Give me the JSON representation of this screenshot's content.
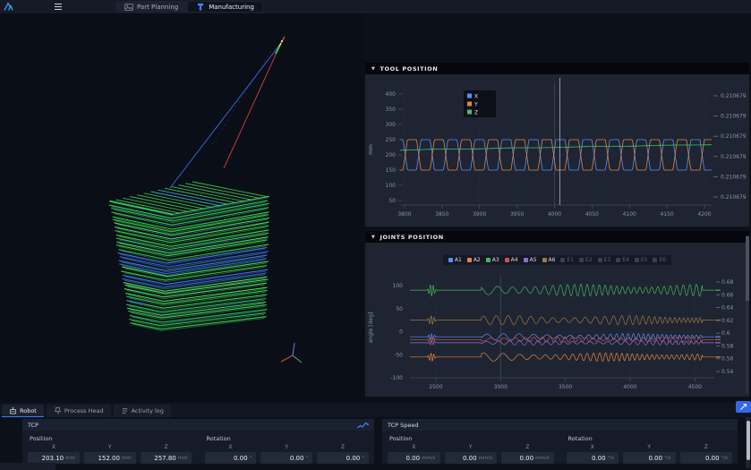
{
  "ui": {
    "collapse_arrow": "▼"
  },
  "topbar": {
    "tabs": [
      {
        "label": "Part Planning",
        "icon": "image",
        "active": false
      },
      {
        "label": "Manufacturing",
        "icon": "machine",
        "active": true
      }
    ]
  },
  "tool_panel": {
    "title": "TOOL POSITION"
  },
  "joints_panel": {
    "title": "JOINTS POSITION"
  },
  "chart_data": [
    {
      "id": "tool_position",
      "type": "line",
      "title": "TOOL POSITION",
      "xlim": [
        3794,
        4212
      ],
      "x_ticks": [
        3800,
        3850,
        3900,
        3950,
        4000,
        4050,
        4100,
        4150,
        4200
      ],
      "ylabel": "mm",
      "ylim": [
        15,
        432
      ],
      "y_ticks": [
        400,
        350,
        300,
        250,
        200,
        150,
        100,
        50
      ],
      "right_axis_labels": [
        "0.210679",
        "0.210679",
        "0.210679",
        "0.210679",
        "0.210679",
        "0.210679"
      ],
      "grid": true,
      "legend_position": "top-left",
      "cursor_x": 4007,
      "series": [
        {
          "name": "X",
          "color": "#5b8ff9",
          "wave": "trapezoid",
          "min": 150,
          "max": 250,
          "period": 36,
          "phase": 0.0
        },
        {
          "name": "Y",
          "color": "#e8853d",
          "wave": "trapezoid",
          "min": 150,
          "max": 250,
          "period": 36,
          "phase": 0.5
        },
        {
          "name": "Z",
          "color": "#41c463",
          "wave": "ramp",
          "from": 216,
          "to": 234
        }
      ]
    },
    {
      "id": "joints_position",
      "type": "line",
      "title": "JOINTS POSITION",
      "xlim": [
        2300,
        4650
      ],
      "x_ticks": [
        2500,
        3000,
        3500,
        4000,
        4500
      ],
      "ylabel": "angle [deg]",
      "ylim": [
        -115,
        115
      ],
      "y_ticks": [
        100,
        50,
        0,
        -50,
        -100
      ],
      "right_axis_labels": [
        "0.68",
        "0.66",
        "0.64",
        "0.62",
        "0.6",
        "0.58",
        "0.56",
        "0.54"
      ],
      "grid": true,
      "legend": [
        {
          "name": "A1",
          "color": "#5b8ff9",
          "enabled": true
        },
        {
          "name": "A2",
          "color": "#e8853d",
          "enabled": true
        },
        {
          "name": "A3",
          "color": "#48b45c",
          "enabled": true
        },
        {
          "name": "A4",
          "color": "#d4504e",
          "enabled": true
        },
        {
          "name": "A5",
          "color": "#8a6fd6",
          "enabled": true
        },
        {
          "name": "A6",
          "color": "#9c7b43",
          "enabled": true
        },
        {
          "name": "E1",
          "color": "#3a404c",
          "enabled": false
        },
        {
          "name": "E2",
          "color": "#3a404c",
          "enabled": false
        },
        {
          "name": "E3",
          "color": "#3a404c",
          "enabled": false
        },
        {
          "name": "E4",
          "color": "#3a404c",
          "enabled": false
        },
        {
          "name": "E5",
          "color": "#3a404c",
          "enabled": false
        },
        {
          "name": "E6",
          "color": "#3a404c",
          "enabled": false
        }
      ],
      "series": [
        {
          "name": "A1",
          "color": "#5b8ff9",
          "base": -11,
          "amp": 7
        },
        {
          "name": "A2",
          "color": "#e8853d",
          "base": -55,
          "amp": 9
        },
        {
          "name": "A3",
          "color": "#48b45c",
          "base": 90,
          "amp": 13
        },
        {
          "name": "A4",
          "color": "#d4504e",
          "base": -17,
          "amp": 6
        },
        {
          "name": "A5",
          "color": "#8a6fd6",
          "base": -24,
          "amp": 5
        },
        {
          "name": "A6",
          "color": "#9c7b43",
          "base": 25,
          "amp": 10
        }
      ],
      "activity": {
        "flat_until": 2420,
        "burst": [
          2432,
          2502
        ],
        "resume": 2852,
        "end": 4558
      }
    }
  ],
  "bottom_panel": {
    "tabs": [
      {
        "label": "Robot",
        "icon": "robot",
        "active": true
      },
      {
        "label": "Process Head",
        "icon": "process-head",
        "active": false
      },
      {
        "label": "Activity log",
        "icon": "log",
        "active": false
      }
    ],
    "cards": [
      {
        "id": "tcp",
        "title": "TCP",
        "has_chart_icon": true,
        "groups": [
          {
            "label": "Position",
            "cols": [
              "X",
              "Y",
              "Z"
            ],
            "values": [
              "203.10",
              "152.00",
              "257.80"
            ],
            "unit": "mm"
          },
          {
            "label": "Rotation",
            "cols": [
              "X",
              "Y",
              "Z"
            ],
            "values": [
              "0.00",
              "0.00",
              "0.00"
            ],
            "unit": "°"
          }
        ]
      },
      {
        "id": "tcp-speed",
        "title": "TCP Speed",
        "has_chart_icon": false,
        "groups": [
          {
            "label": "Position",
            "cols": [
              "X",
              "Y",
              "Z"
            ],
            "values": [
              "0.00",
              "0.00",
              "0.00"
            ],
            "unit": "mm/s"
          },
          {
            "label": "Rotation",
            "cols": [
              "X",
              "Y",
              "Z"
            ],
            "values": [
              "0.00",
              "0.00",
              "0.00"
            ],
            "unit": "°/s"
          }
        ]
      }
    ]
  },
  "colors": {
    "accent_blue": "#3d7bfd",
    "panel_bg": "#1e2432",
    "page_bg": "#0c1018",
    "toolpath_green": "#3ad64b",
    "toolpath_blue": "#3a66ec"
  }
}
